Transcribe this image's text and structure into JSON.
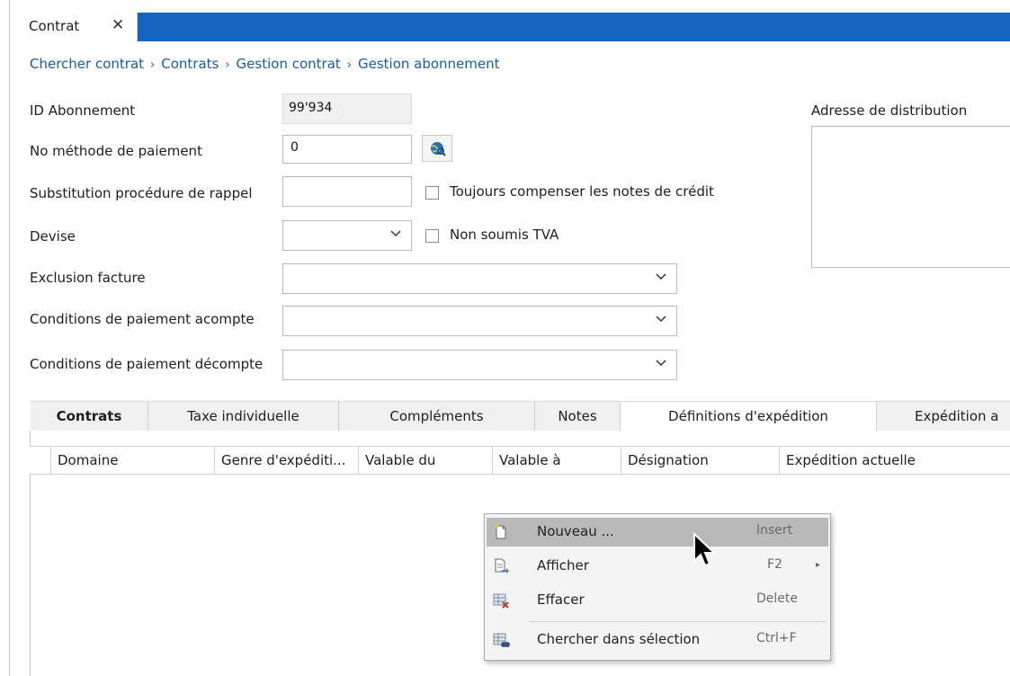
{
  "window": {
    "tab_title": "Contrat",
    "tab_close": "✕"
  },
  "breadcrumb": {
    "items": [
      "Chercher contrat",
      "Contrats",
      "Gestion contrat",
      "Gestion abonnement"
    ],
    "separator": "›"
  },
  "form": {
    "id_label": "ID Abonnement",
    "id_value": "99'934",
    "payment_method_label": "No méthode de paiement",
    "payment_method_value": "0",
    "reminder_label": "Substitution procédure de rappel",
    "reminder_value": "",
    "always_compensate_label": "Toujours compenser les notes de crédit",
    "currency_label": "Devise",
    "currency_value": "",
    "no_vat_label": "Non soumis TVA",
    "invoice_exclusion_label": "Exclusion facture",
    "invoice_exclusion_value": "",
    "payment_terms_deposit_label": "Conditions de paiement acompte",
    "payment_terms_deposit_value": "",
    "payment_terms_settlement_label": "Conditions de paiement décompte",
    "payment_terms_settlement_value": "",
    "address_label": "Adresse de distribution"
  },
  "tabs": [
    {
      "label": "Contrats"
    },
    {
      "label": "Taxe individuelle"
    },
    {
      "label": "Compléments"
    },
    {
      "label": "Notes"
    },
    {
      "label": "Définitions d'expédition"
    },
    {
      "label": "Expédition a"
    }
  ],
  "grid": {
    "columns": [
      "Domaine",
      "Genre d'expéditi...",
      "Valable du",
      "Valable à",
      "Désignation",
      "Expédition actuelle"
    ]
  },
  "context_menu": {
    "items": [
      {
        "label": "Nouveau ...",
        "shortcut": "Insert",
        "icon": "new-document-icon"
      },
      {
        "label": "Afficher",
        "shortcut": "F2",
        "icon": "view-document-icon",
        "submenu": "▸"
      },
      {
        "label": "Effacer",
        "shortcut": "Delete",
        "icon": "delete-table-icon"
      },
      {
        "label": "Chercher dans sélection",
        "shortcut": "Ctrl+F",
        "icon": "search-table-icon"
      }
    ]
  },
  "colors": {
    "accent": "#1565c0",
    "link": "#1a5ba8",
    "menu_highlight": "#b9b9b9"
  }
}
